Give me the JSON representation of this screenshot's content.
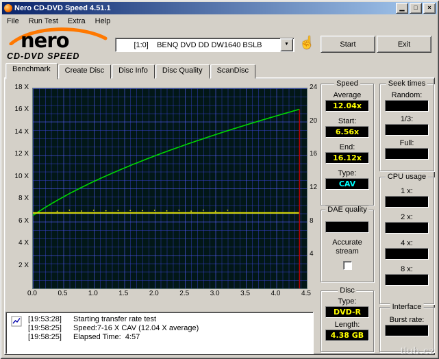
{
  "window": {
    "title": "Nero CD-DVD Speed 4.51.1"
  },
  "icons": {
    "minimize": "▁",
    "maximize": "□",
    "close": "×",
    "dropdown_arrow": "▼",
    "eject_hand": "☝"
  },
  "menu": {
    "items": [
      "File",
      "Run Test",
      "Extra",
      "Help"
    ]
  },
  "logo": {
    "line1": "nero",
    "line2": "CD-DVD SPEED"
  },
  "toolbar": {
    "drive_select": "[1:0]    BENQ DVD DD DW1640 BSLB",
    "start_label": "Start",
    "exit_label": "Exit"
  },
  "tabs": [
    "Benchmark",
    "Create Disc",
    "Disc Info",
    "Disc Quality",
    "ScanDisc"
  ],
  "active_tab": "Benchmark",
  "panels": {
    "speed": {
      "title": "Speed",
      "rows": [
        {
          "label": "Average",
          "value": "12.04x",
          "color": "#ffff00"
        },
        {
          "label": "Start:",
          "value": "6.56x",
          "color": "#ffff00"
        },
        {
          "label": "End:",
          "value": "16.12x",
          "color": "#ffff00"
        },
        {
          "label": "Type:",
          "value": "CAV",
          "color": "#00ffff"
        }
      ]
    },
    "seek": {
      "title": "Seek times",
      "rows": [
        {
          "label": "Random:",
          "value": "",
          "color": "#ffff00"
        },
        {
          "label": "1/3:",
          "value": "",
          "color": "#ffff00"
        },
        {
          "label": "Full:",
          "value": "",
          "color": "#ffff00"
        }
      ]
    },
    "cpu": {
      "title": "CPU usage",
      "rows": [
        {
          "label": "1 x:",
          "value": "",
          "color": "#ffff00"
        },
        {
          "label": "2 x:",
          "value": "",
          "color": "#ffff00"
        },
        {
          "label": "4 x:",
          "value": "",
          "color": "#ffff00"
        },
        {
          "label": "8 x:",
          "value": "",
          "color": "#ffff00"
        }
      ]
    },
    "dae": {
      "title": "DAE quality",
      "value": "",
      "accurate_label": "Accurate stream",
      "checkbox_checked": false
    },
    "disc": {
      "title": "Disc",
      "rows": [
        {
          "label": "Type:",
          "value": "DVD-R",
          "color": "#ffff00"
        },
        {
          "label": "Length:",
          "value": "4.38 GB",
          "color": "#ffff00"
        }
      ]
    },
    "interface": {
      "title": "Interface",
      "rows": [
        {
          "label": "Burst rate:",
          "value": "",
          "color": "#ffff00"
        }
      ]
    }
  },
  "log": {
    "lines": [
      {
        "time": "[19:53:28]",
        "text": "Starting transfer rate test"
      },
      {
        "time": "[19:58:25]",
        "text": "Speed:7-16 X CAV (12.04 X average)"
      },
      {
        "time": "[19:58:25]",
        "text": "Elapsed Time:  4:57"
      }
    ]
  },
  "chart_data": {
    "type": "line",
    "title": "",
    "x_axis": {
      "label": "",
      "unit": "GB",
      "min": 0,
      "max": 4.5,
      "ticks": [
        "0.0",
        "0.5",
        "1.0",
        "1.5",
        "2.0",
        "2.5",
        "3.0",
        "3.5",
        "4.0",
        "4.5"
      ]
    },
    "y_axis_left": {
      "min": 0,
      "max": 18,
      "ticks": [
        "2 X",
        "4 X",
        "6 X",
        "8 X",
        "10 X",
        "12 X",
        "14 X",
        "16 X",
        "18 X"
      ]
    },
    "y_axis_right": {
      "min": 0,
      "max": 24,
      "ticks": [
        "4",
        "8",
        "12",
        "16",
        "20",
        "24"
      ]
    },
    "series": [
      {
        "name": "transfer-rate",
        "type": "cav-curve",
        "color": "#00d800",
        "start": {
          "x": 0,
          "speed": 6.56
        },
        "end": {
          "x": 4.38,
          "speed": 16.12
        }
      },
      {
        "name": "rotation-speed",
        "type": "flat",
        "color": "#e6e600",
        "value": 6.8,
        "x_start": 0,
        "x_end": 4.38
      }
    ],
    "end_marker": {
      "x": 4.38,
      "color": "#b80000"
    },
    "grid": {
      "on": true,
      "color": "#3741d2",
      "minor_x_step_gb": 0.1,
      "minor_y_step": 1
    }
  },
  "watermark": "tlub.cz"
}
